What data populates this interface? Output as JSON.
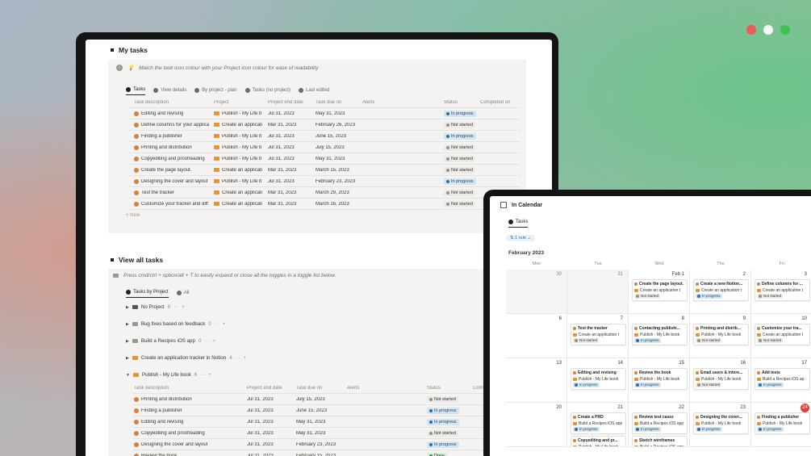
{
  "colors": {
    "red": "#ee5a5a",
    "white": "#f5f5f5",
    "green": "#3ec24f",
    "orange_icon": "#d5803b",
    "folder": "#e49437"
  },
  "my_tasks": {
    "title": "My tasks",
    "tip": "Match the task icon colour with your Project icon colour for ease of readability",
    "tabs": [
      "Tasks",
      "View details",
      "By project - plan",
      "Tasks (no project)",
      "Last edited"
    ],
    "columns": [
      "Task description",
      "Project",
      "Project end date",
      "Task due on",
      "Alerts",
      "Status",
      "Completed on"
    ],
    "rows": [
      {
        "task": "Editing and revising",
        "project": "Publish - My Life b",
        "end": "Jul 31, 2023",
        "due": "May 31, 2023",
        "status": "In progress",
        "s": "prog"
      },
      {
        "task": "Define columns for your applica",
        "project": "Create an applicati",
        "end": "Mar 31, 2023",
        "due": "February 26, 2023",
        "status": "Not started",
        "s": "not"
      },
      {
        "task": "Finding a publisher",
        "project": "Publish - My Life b",
        "end": "Jul 31, 2023",
        "due": "June 15, 2023",
        "status": "In progress",
        "s": "prog"
      },
      {
        "task": "Printing and distribution",
        "project": "Publish - My Life b",
        "end": "Jul 31, 2023",
        "due": "July 15, 2023",
        "status": "Not started",
        "s": "not"
      },
      {
        "task": "Copyediting and proofreading",
        "project": "Publish - My Life b",
        "end": "Jul 31, 2023",
        "due": "May 31, 2023",
        "status": "Not started",
        "s": "not"
      },
      {
        "task": "Create the page layout.",
        "project": "Create an applicati",
        "end": "Mar 31, 2023",
        "due": "March 15, 2023",
        "status": "Not started",
        "s": "not"
      },
      {
        "task": "Designing the cover and layout",
        "project": "Publish - My Life b",
        "end": "Jul 31, 2023",
        "due": "February 23, 2023",
        "status": "In progress",
        "s": "prog"
      },
      {
        "task": "Test the tracker",
        "project": "Create an applicati",
        "end": "Mar 31, 2023",
        "due": "March 29, 2023",
        "status": "Not started",
        "s": "not"
      },
      {
        "task": "Customize your tracker and diff",
        "project": "Create an applicati",
        "end": "Mar 31, 2023",
        "due": "March 16, 2023",
        "status": "Not started",
        "s": "not"
      }
    ],
    "new_label": "+ New"
  },
  "view_all": {
    "title": "View all tasks",
    "tip": "Press cmd/ctrl + option/alt + T to easily expand or close all the toggles in a toggle list below.",
    "tabs": [
      "Tasks by Project",
      "All"
    ],
    "groups": [
      {
        "name": "No Project",
        "count": "0"
      },
      {
        "name": "Bug fixes based on feedback",
        "count": "0"
      },
      {
        "name": "Build a Recipes iOS app",
        "count": "0"
      },
      {
        "name": "Create an application tracker in Notion",
        "count": "4"
      },
      {
        "name": "Publish - My Life book",
        "count": "6"
      }
    ],
    "columns": [
      "Task description",
      "Project end date",
      "Task due on",
      "Alerts",
      "Status",
      "Comp"
    ],
    "rows": [
      {
        "task": "Printing and distribution",
        "end": "Jul 31, 2023",
        "due": "July 15, 2023",
        "status": "Not started",
        "s": "not"
      },
      {
        "task": "Finding a publisher",
        "end": "Jul 31, 2023",
        "due": "June 15, 2023",
        "status": "In progress",
        "s": "prog"
      },
      {
        "task": "Editing and revising",
        "end": "Jul 31, 2023",
        "due": "May 31, 2023",
        "status": "In progress",
        "s": "prog"
      },
      {
        "task": "Copyediting and proofreading",
        "end": "Jul 31, 2023",
        "due": "May 31, 2023",
        "status": "Not started",
        "s": "not"
      },
      {
        "task": "Designing the cover and layout",
        "end": "Jul 31, 2023",
        "due": "February 23, 2023",
        "status": "In progress",
        "s": "prog"
      },
      {
        "task": "Review the book",
        "end": "Jul 31, 2023",
        "due": "February 15, 2023",
        "status": "Done",
        "s": "done"
      }
    ]
  },
  "calendar": {
    "title": "In Calendar",
    "tab": "Tasks",
    "filter": "1 rule",
    "month": "February 2023",
    "dows": [
      "Mon",
      "Tue",
      "Wed",
      "Thu",
      "Fri"
    ],
    "weeks": [
      [
        {
          "d": "30",
          "m": true
        },
        {
          "d": "31",
          "m": true
        },
        {
          "d": "Feb 1"
        },
        {
          "d": "2"
        },
        {
          "d": "3"
        }
      ],
      [
        {
          "d": "6"
        },
        {
          "d": "7"
        },
        {
          "d": "8"
        },
        {
          "d": "9"
        },
        {
          "d": "10"
        }
      ],
      [
        {
          "d": "13"
        },
        {
          "d": "14"
        },
        {
          "d": "15"
        },
        {
          "d": "16"
        },
        {
          "d": "17"
        }
      ],
      [
        {
          "d": "20"
        },
        {
          "d": "21"
        },
        {
          "d": "22"
        },
        {
          "d": "23"
        },
        {
          "d": "24",
          "today": true
        }
      ]
    ],
    "cards": [
      {
        "w": 0,
        "c": 2,
        "t": "Create the page layout.",
        "p": "Create an application t",
        "s": "Not started",
        "k": "not"
      },
      {
        "w": 0,
        "c": 3,
        "t": "Create a new Notion...",
        "p": "Create an application t",
        "s": "In progress",
        "k": "prog"
      },
      {
        "w": 0,
        "c": 4,
        "t": "Define columns for ...",
        "p": "Create an application t",
        "s": "Not started",
        "k": "not"
      },
      {
        "w": 1,
        "c": 1,
        "t": "Test the tracker",
        "p": "Create an application t",
        "s": "Not started",
        "k": "not"
      },
      {
        "w": 1,
        "c": 2,
        "t": "Contacting publishi...",
        "p": "Publish - My Life book",
        "s": "In progress",
        "k": "prog"
      },
      {
        "w": 1,
        "c": 3,
        "t": "Printing and distrib...",
        "p": "Publish - My Life book",
        "s": "Not started",
        "k": "not"
      },
      {
        "w": 1,
        "c": 4,
        "t": "Customize your tra...",
        "p": "Create an application t",
        "s": "Not started",
        "k": "not"
      },
      {
        "w": 2,
        "c": 1,
        "t": "Editing and revising",
        "p": "Publish - My Life book",
        "s": "In progress",
        "k": "prog"
      },
      {
        "w": 2,
        "c": 2,
        "t": "Review the book",
        "p": "Publish - My Life book",
        "s": "In progress",
        "k": "prog"
      },
      {
        "w": 2,
        "c": 3,
        "t": "Email users & intere...",
        "p": "Publish - My Life book",
        "s": "Not started",
        "k": "not"
      },
      {
        "w": 2,
        "c": 4,
        "t": "Add tests",
        "p": "Build a Recipes iOS ap",
        "s": "In progress",
        "k": "prog"
      },
      {
        "w": 3,
        "c": 1,
        "t": "Create a PRD",
        "p": "Build a Recipes iOS app",
        "s": "In progress",
        "k": "prog"
      },
      {
        "w": 3,
        "c": 2,
        "t": "Review test cases",
        "p": "Build a Recipes iOS app",
        "s": "In progress",
        "k": "prog"
      },
      {
        "w": 3,
        "c": 3,
        "t": "Designing the cover...",
        "p": "Publish - My Life book",
        "s": "In progress",
        "k": "prog"
      },
      {
        "w": 3,
        "c": 4,
        "t": "Finding a publisher",
        "p": "Publish - My Life book",
        "s": "In progress",
        "k": "prog"
      }
    ],
    "extra_cards": [
      {
        "w": 3,
        "c": 1,
        "t": "Copyediting and pr...",
        "p": "Publish - My Life book"
      },
      {
        "w": 3,
        "c": 2,
        "t": "Sketch wireframes",
        "p": "Build a Recipes iOS app"
      }
    ]
  }
}
